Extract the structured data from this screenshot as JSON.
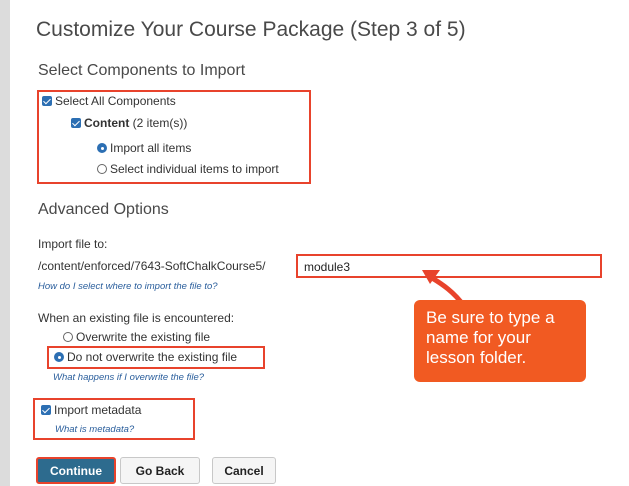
{
  "page_title": "Customize Your Course Package (Step 3 of 5)",
  "select_components": {
    "heading": "Select Components to Import",
    "select_all_label": "Select All Components",
    "content_label": "Content",
    "content_count": "(2 item(s))",
    "import_all_label": "Import all items",
    "select_individual_label": "Select individual items to import"
  },
  "advanced": {
    "heading": "Advanced Options",
    "import_file_label": "Import file to:",
    "path_prefix": "/content/enforced/7643-SoftChalkCourse5/",
    "path_value": "module3",
    "help_import": "How do I select where to import the file to?",
    "existing_label": "When an existing file is encountered:",
    "overwrite_label": "Overwrite the existing file",
    "no_overwrite_label": "Do not overwrite the existing file",
    "help_overwrite": "What happens if I overwrite the file?",
    "metadata_label": "Import metadata",
    "help_metadata": "What is metadata?"
  },
  "annotation": {
    "text": "Be sure to type a name for your lesson folder."
  },
  "buttons": {
    "continue": "Continue",
    "go_back": "Go Back",
    "cancel": "Cancel"
  },
  "colors": {
    "highlight": "#e8432c",
    "annotation_bg": "#f15a22",
    "primary_button": "#2d6b8e",
    "checkbox": "#2c6fb3",
    "link": "#2a5e9c"
  }
}
